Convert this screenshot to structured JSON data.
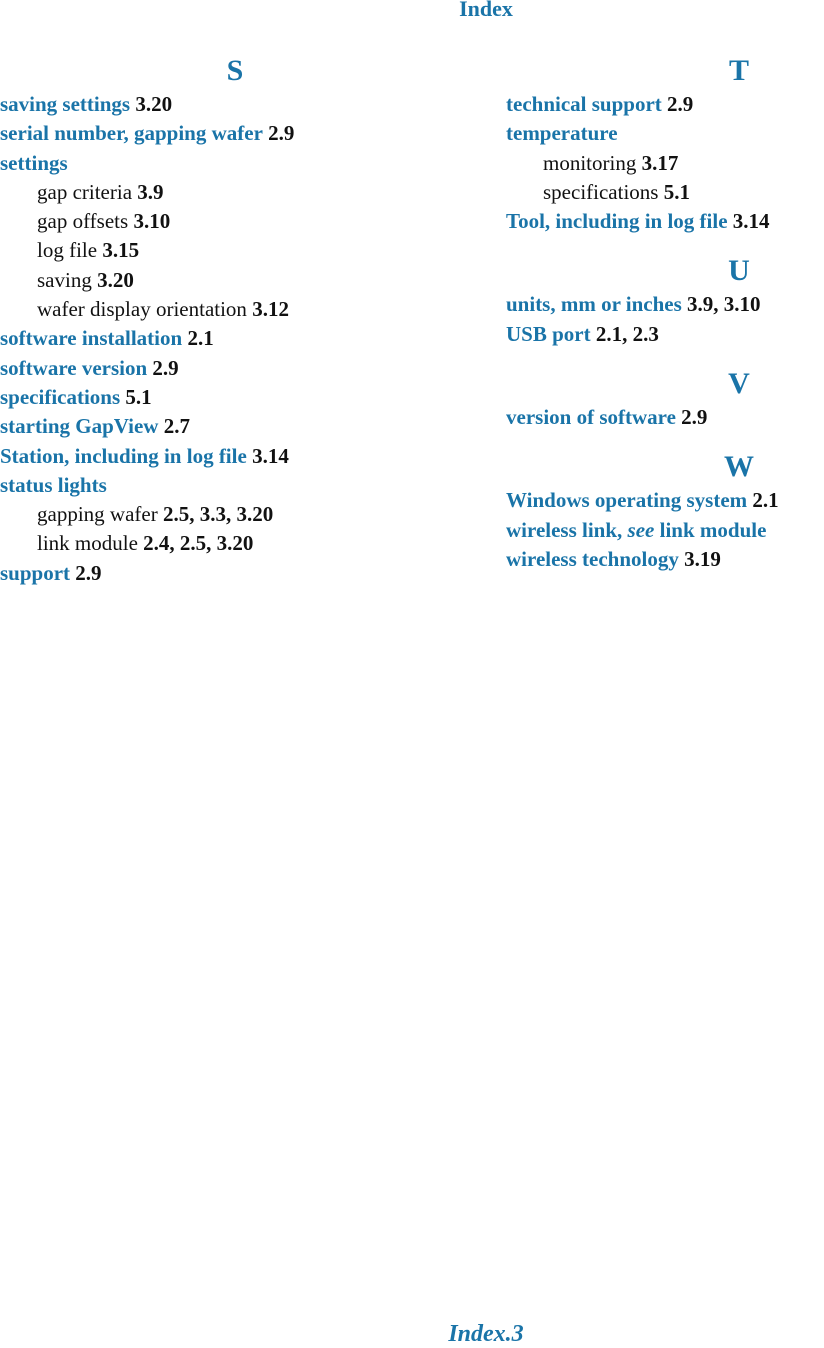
{
  "header": {
    "title": "Index"
  },
  "footer": {
    "page_label": "Index.3"
  },
  "colors": {
    "accent": "#1a74a8",
    "text": "#111111"
  },
  "sections": {
    "S": {
      "letter": "S",
      "entries": [
        {
          "term": "saving settings",
          "pages": "3.20"
        },
        {
          "term": "serial number, gapping wafer",
          "pages": "2.9"
        },
        {
          "term": "settings",
          "pages": ""
        },
        {
          "term": "gap criteria",
          "pages": "3.9",
          "sub": true
        },
        {
          "term": "gap offsets",
          "pages": "3.10",
          "sub": true
        },
        {
          "term": "log file",
          "pages": "3.15",
          "sub": true
        },
        {
          "term": "saving",
          "pages": "3.20",
          "sub": true
        },
        {
          "term": "wafer display orientation",
          "pages": "3.12",
          "sub": true
        },
        {
          "term": "software installation",
          "pages": "2.1"
        },
        {
          "term": "software version",
          "pages": "2.9"
        },
        {
          "term": "specifications",
          "pages": "5.1"
        },
        {
          "term": "starting GapView",
          "pages": "2.7"
        },
        {
          "term": "Station, including in log file",
          "pages": "3.14"
        },
        {
          "term": "status lights",
          "pages": ""
        },
        {
          "term": "gapping wafer",
          "pages": "2.5, 3.3, 3.20",
          "sub": true
        },
        {
          "term": "link module",
          "pages": "2.4, 2.5, 3.20",
          "sub": true
        },
        {
          "term": "support",
          "pages": "2.9"
        }
      ]
    },
    "T": {
      "letter": "T",
      "entries": [
        {
          "term": "technical support",
          "pages": "2.9"
        },
        {
          "term": "temperature",
          "pages": ""
        },
        {
          "term": "monitoring",
          "pages": "3.17",
          "sub": true
        },
        {
          "term": "specifications",
          "pages": "5.1",
          "sub": true
        },
        {
          "term": "Tool, including in log file",
          "pages": "3.14"
        }
      ]
    },
    "U": {
      "letter": "U",
      "entries": [
        {
          "term": "units, mm or inches",
          "pages": "3.9, 3.10"
        },
        {
          "term": "USB port",
          "pages": "2.1, 2.3"
        }
      ]
    },
    "V": {
      "letter": "V",
      "entries": [
        {
          "term": "version of software",
          "pages": "2.9"
        }
      ]
    },
    "W": {
      "letter": "W",
      "entries": [
        {
          "term": "Windows operating system",
          "pages": "2.1"
        },
        {
          "term": "wireless link,",
          "see": "see",
          "see_target": "link module",
          "pages": ""
        },
        {
          "term": "wireless technology",
          "pages": "3.19"
        }
      ]
    }
  }
}
